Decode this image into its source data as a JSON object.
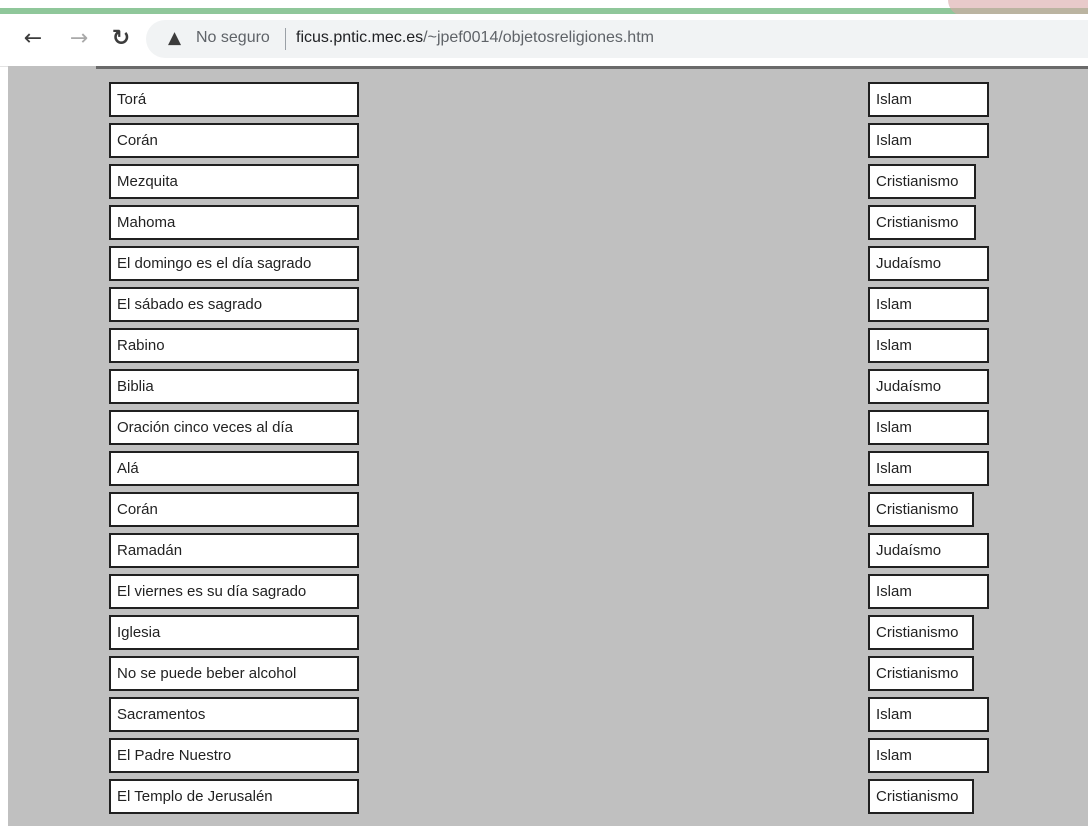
{
  "browser": {
    "security_text": "No seguro",
    "url_host": "ficus.pntic.mec.es",
    "url_path": "/~jpef0014/objetosreligiones.htm",
    "icons": {
      "back": "arrow-left-icon",
      "forward": "arrow-right-icon",
      "reload": "reload-icon",
      "warning": "warning-triangle-icon"
    }
  },
  "colors": {
    "page_background": "#c0c0c0",
    "tab_strip_accent": "#8fc79a"
  },
  "items": [
    "Torá",
    "Corán",
    "Mezquita",
    "Mahoma",
    "El domingo es el día sagrado",
    "El sábado es sagrado",
    "Rabino",
    "Biblia",
    "Oración cinco veces al día",
    "Alá",
    "Corán",
    "Ramadán",
    "El viernes es su día sagrado",
    "Iglesia",
    "No se puede beber alcohol",
    "Sacramentos",
    "El Padre Nuestro",
    "El Templo de Jerusalén"
  ],
  "religion_selects": [
    "Islam",
    "Islam",
    "Cristianismo",
    "Cristianismo",
    "Judaísmo",
    "Islam",
    "Islam",
    "Judaísmo",
    "Islam",
    "Islam",
    "Cristianismo",
    "Judaísmo",
    "Islam",
    "Cristianismo",
    "Cristianismo",
    "Islam",
    "Islam",
    "Cristianismo"
  ]
}
